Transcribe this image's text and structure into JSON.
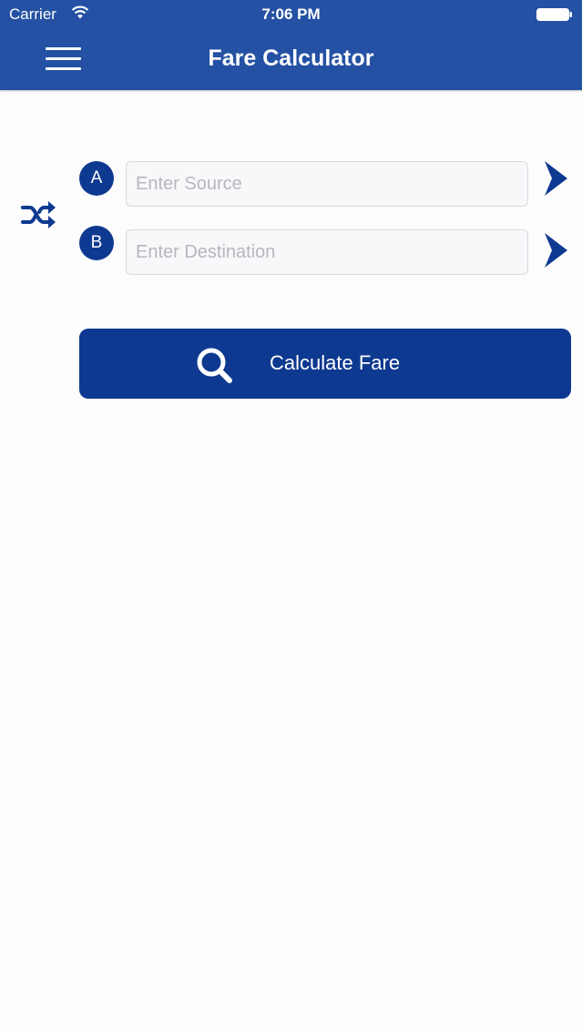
{
  "status_bar": {
    "carrier": "Carrier",
    "time": "7:06 PM"
  },
  "header": {
    "title": "Fare Calculator",
    "menu_icon": "hamburger-menu-icon"
  },
  "route": {
    "swap_icon": "shuffle-icon",
    "source": {
      "badge": "A",
      "value": "",
      "placeholder": "Enter Source",
      "go_icon": "chevron-right-icon"
    },
    "destination": {
      "badge": "B",
      "value": "",
      "placeholder": "Enter Destination",
      "go_icon": "chevron-right-icon"
    }
  },
  "calculate": {
    "label": "Calculate Fare",
    "icon": "search-icon"
  },
  "colors": {
    "header": "#2451a3",
    "accent": "#0e3990",
    "background": "#fdfdfe"
  }
}
